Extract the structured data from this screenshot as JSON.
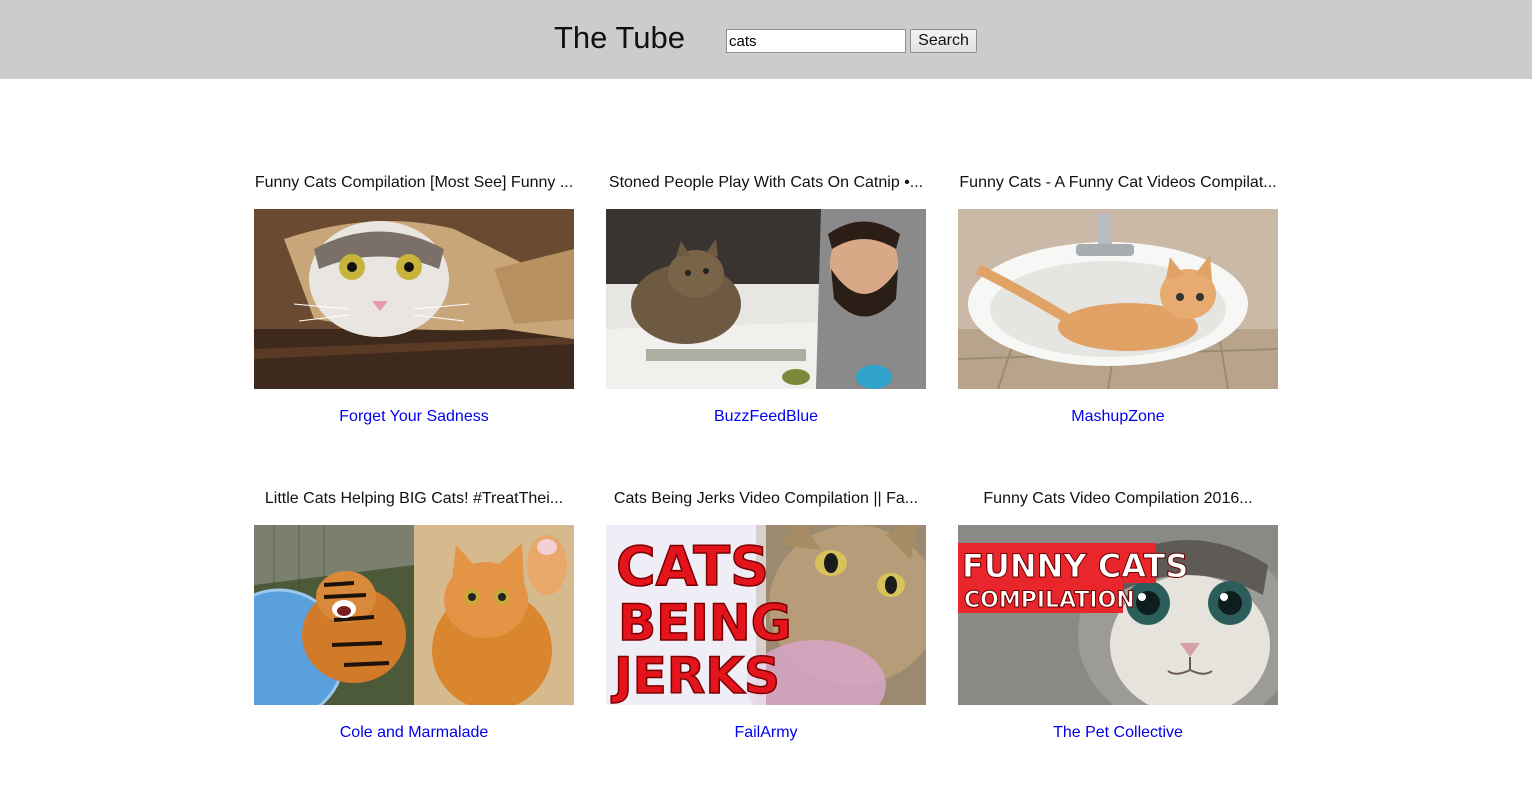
{
  "header": {
    "title": "The Tube",
    "search_value": "cats",
    "search_button": "Search"
  },
  "videos": [
    {
      "title": "Funny Cats Compilation [Most See] Funny ...",
      "channel": "Forget Your Sadness"
    },
    {
      "title": "Stoned People Play With Cats On Catnip •...",
      "channel": "BuzzFeedBlue"
    },
    {
      "title": "Funny Cats - A Funny Cat Videos Compilat...",
      "channel": "MashupZone"
    },
    {
      "title": "Little Cats Helping BIG Cats! #TreatThei...",
      "channel": "Cole and Marmalade"
    },
    {
      "title": "Cats Being Jerks Video Compilation || Fa...",
      "channel": "FailArmy"
    },
    {
      "title": "Funny Cats Video Compilation 2016...",
      "channel": "The Pet Collective"
    }
  ],
  "thumbnail_text": {
    "jerks": [
      "CATS",
      "BEING",
      "JERKS"
    ],
    "funny": [
      "FUNNY CATS",
      "COMPILATION"
    ]
  },
  "colors": {
    "header_bg": "#cccccc",
    "link": "#0000ee"
  }
}
